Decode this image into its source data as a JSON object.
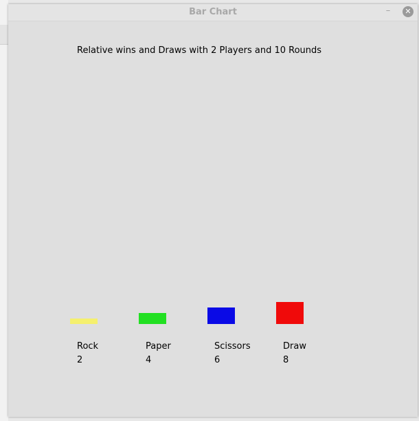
{
  "window": {
    "title": "Bar Chart",
    "minimize_glyph": "–",
    "close_glyph": "✕"
  },
  "chart_data": {
    "type": "bar",
    "title": "Relative wins and Draws with 2 Players and 10 Rounds",
    "categories": [
      "Rock",
      "Paper",
      "Scissors",
      "Draw"
    ],
    "values": [
      2,
      4,
      6,
      8
    ],
    "colors": [
      "#f5f06e",
      "#22e022",
      "#0a0ae6",
      "#f00a0a"
    ],
    "ylim": [
      0,
      100
    ],
    "grid": false,
    "legend": "none"
  }
}
